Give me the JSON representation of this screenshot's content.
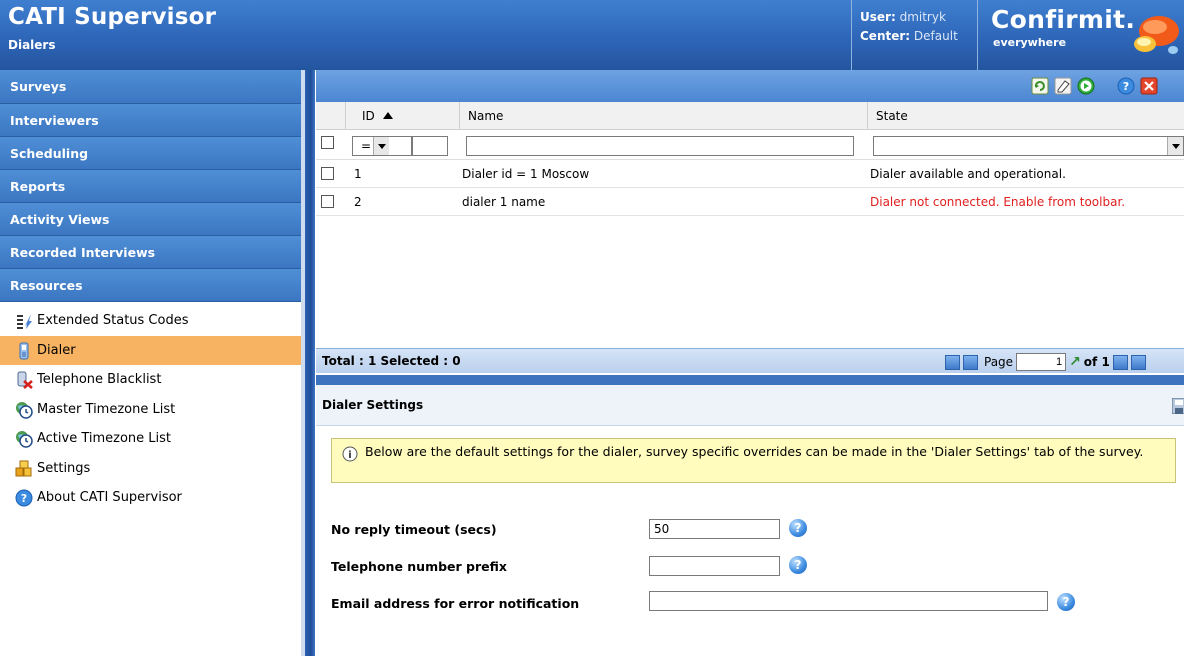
{
  "header": {
    "app_title": "CATI Supervisor",
    "page_subtitle": "Dialers",
    "user_label": "User:",
    "user_value": "dmitryk",
    "center_label": "Center:",
    "center_value": "Default",
    "brand": "Confirmit.",
    "brand_tagline": "everywhere"
  },
  "sidebar": {
    "nav": [
      {
        "label": "Surveys"
      },
      {
        "label": "Interviewers"
      },
      {
        "label": "Scheduling"
      },
      {
        "label": "Reports"
      },
      {
        "label": "Activity Views"
      },
      {
        "label": "Recorded Interviews"
      },
      {
        "label": "Resources"
      }
    ],
    "resources": [
      {
        "label": "Extended Status Codes",
        "icon": "status-codes-icon"
      },
      {
        "label": "Dialer",
        "icon": "phone-icon",
        "active": true
      },
      {
        "label": "Telephone Blacklist",
        "icon": "blacklist-icon"
      },
      {
        "label": "Master Timezone List",
        "icon": "timezone-icon"
      },
      {
        "label": "Active Timezone List",
        "icon": "timezone-icon"
      },
      {
        "label": "Settings",
        "icon": "settings-icon"
      },
      {
        "label": "About CATI Supervisor",
        "icon": "help-icon"
      }
    ]
  },
  "grid": {
    "toolbar_icons": [
      "refresh-icon",
      "eraser-icon",
      "play-icon",
      "help-icon",
      "close-icon"
    ],
    "columns": {
      "id": "ID",
      "name": "Name",
      "state": "State"
    },
    "filter": {
      "operator": "=",
      "id_value": "",
      "name_value": "",
      "state_value": ""
    },
    "rows": [
      {
        "id": "1",
        "name": "Dialer id = 1 Moscow",
        "state": "Dialer available and operational.",
        "state_error": false
      },
      {
        "id": "2",
        "name": "dialer 1 name",
        "state": "Dialer not connected. Enable from toolbar.",
        "state_error": true
      }
    ],
    "footer": {
      "summary": "Total : 1 Selected : 0",
      "page_label": "Page",
      "page_value": "1",
      "of_label": "of 1"
    }
  },
  "settings": {
    "title": "Dialer Settings",
    "info": "Below are the default settings for the dialer, survey specific overrides can be made in the 'Dialer Settings' tab of the survey.",
    "fields": {
      "no_reply_label": "No reply timeout (secs)",
      "no_reply_value": "50",
      "prefix_label": "Telephone number prefix",
      "prefix_value": "",
      "email_label": "Email address for error notification",
      "email_value": ""
    }
  },
  "colors": {
    "header_blue": "#2e66b8",
    "active_item": "#f7b361",
    "error_text": "#e01f1f",
    "info_bg": "#fffcbe"
  }
}
